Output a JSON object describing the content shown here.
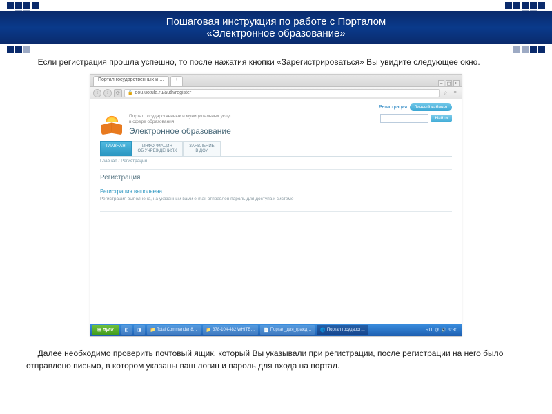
{
  "slide": {
    "title_line1": "Пошаговая инструкция по работе с Порталом",
    "title_line2": "«Электронное образование»",
    "intro": "     Если регистрация прошла успешно, то после нажатия кнопки «Зарегистрироваться» Вы увидите следующее окно.",
    "outro": "     Далее необходимо проверить почтовый ящик, который Вы указывали при регистрации, после регистрации на него было отправлено письмо, в котором указаны ваш логин и пароль для входа на портал."
  },
  "browser": {
    "tab_title": "Портал государственных и …",
    "url": "dou.uotula.ru/auth/register"
  },
  "portal": {
    "top_register_link": "Регистрация",
    "top_cabinet_btn": "Личный кабинет",
    "subtitle_line1": "Портал государственных и муниципальных услуг",
    "subtitle_line2": "в сфере образования",
    "main_title": "Электронное образование",
    "search_btn": "Найти",
    "tabs": [
      {
        "label": "ГЛАВНАЯ"
      },
      {
        "label_line1": "ИНФОРМАЦИЯ",
        "label_line2": "ОБ УЧРЕЖДЕНИЯХ"
      },
      {
        "label_line1": "ЗАЯВЛЕНИЕ",
        "label_line2": "В ДОУ"
      }
    ],
    "breadcrumb_root": "Главная",
    "breadcrumb_current": "Регистрация",
    "section_title": "Регистрация",
    "status_heading": "Регистрация выполнена",
    "status_text": "Регистрация выполнена, на указанный вами e-mail отправлен пароль для доступа к системе"
  },
  "taskbar": {
    "start": "пуск",
    "items": [
      "Total Commander 8…",
      "378-104-482 WHITE…",
      "Портал_для_гражд…",
      "Портал государст…"
    ],
    "lang": "RU",
    "time": "9:30"
  }
}
